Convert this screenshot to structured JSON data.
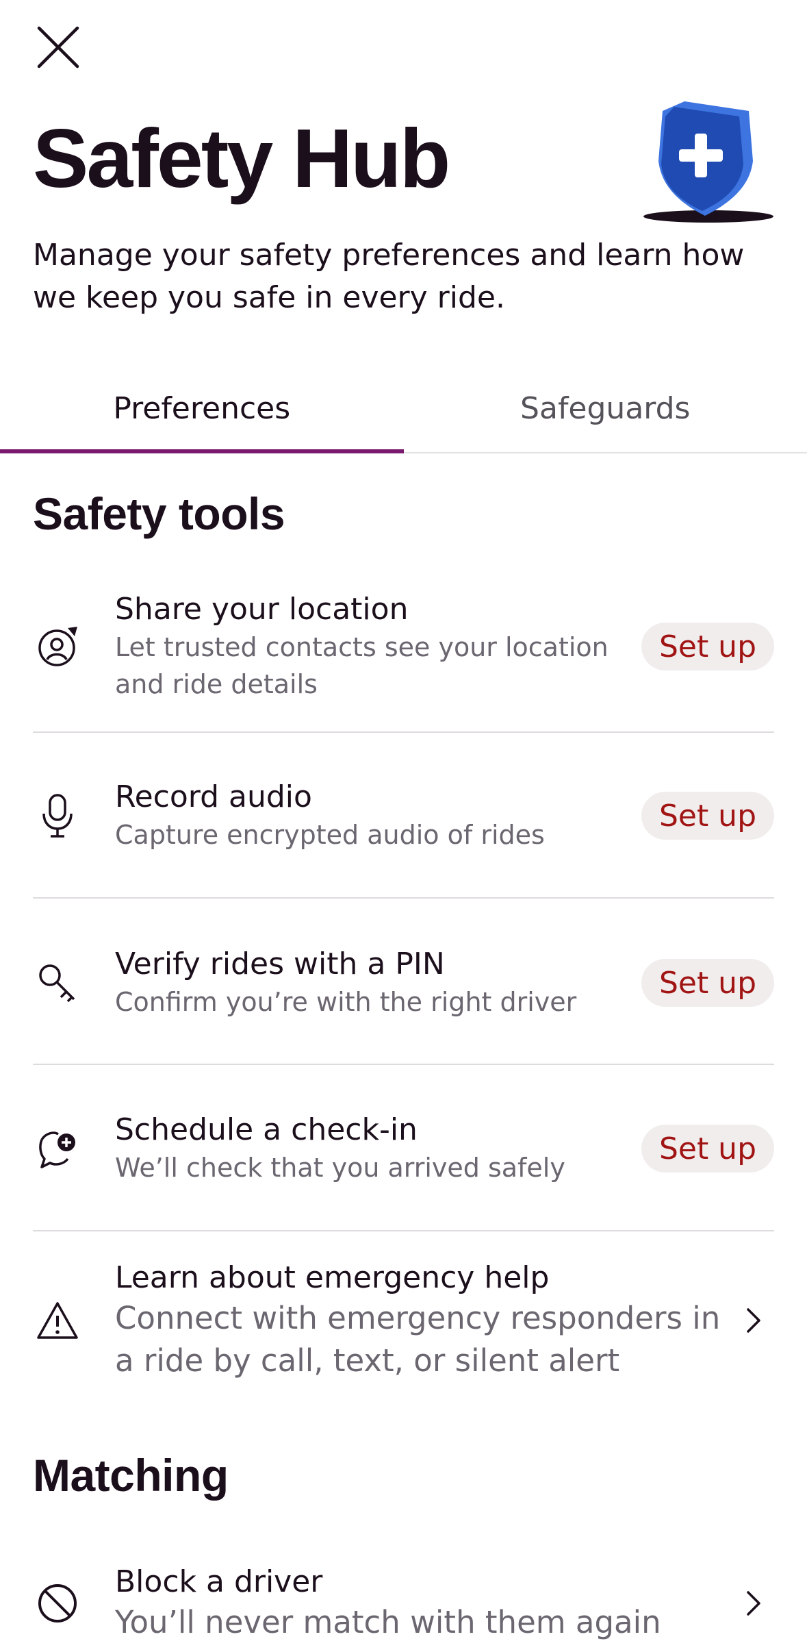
{
  "header": {
    "title": "Safety Hub",
    "subtitle": "Manage your safety preferences and learn how we keep you safe in every ride."
  },
  "tabs": [
    {
      "label": "Preferences",
      "active": true
    },
    {
      "label": "Safeguards",
      "active": false
    }
  ],
  "sections": {
    "safety_tools": {
      "title": "Safety tools",
      "items": [
        {
          "icon": "location-share-icon",
          "title": "Share your location",
          "description": "Let trusted contacts see your location and ride details",
          "action": "Set up"
        },
        {
          "icon": "microphone-icon",
          "title": "Record audio",
          "description": "Capture encrypted audio of rides",
          "action": "Set up"
        },
        {
          "icon": "key-icon",
          "title": "Verify rides with a PIN",
          "description": "Confirm you’re with the right driver",
          "action": "Set up"
        },
        {
          "icon": "check-in-bubble-icon",
          "title": "Schedule a check-in",
          "description": "We’ll check that you arrived safely",
          "action": "Set up"
        },
        {
          "icon": "warning-triangle-icon",
          "title": "Learn about emergency help",
          "description": "Connect with emergency responders in a ride by call, text, or silent alert"
        }
      ]
    },
    "matching": {
      "title": "Matching",
      "items": [
        {
          "icon": "block-icon",
          "title": "Block a driver",
          "description": "You’ll never match with them again"
        }
      ]
    }
  },
  "colors": {
    "accent": "#7a1a6e",
    "action_text": "#a11414",
    "action_bg": "#f2eded",
    "shield_blue": "#1f4bb3"
  }
}
